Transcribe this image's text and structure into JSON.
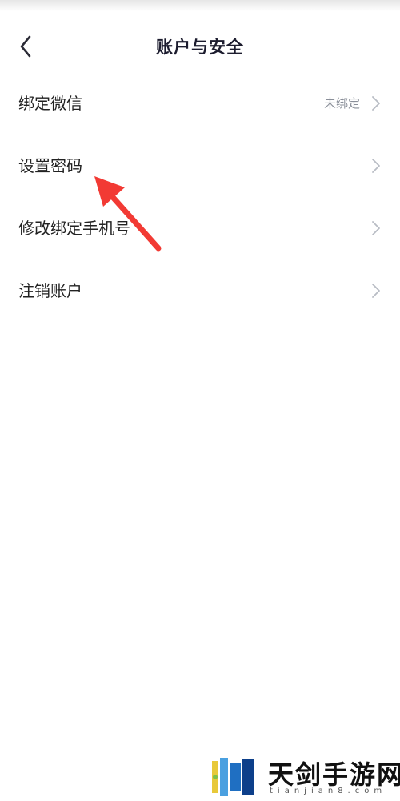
{
  "header": {
    "title": "账户与安全",
    "back_icon": "chevron-left-icon"
  },
  "menu": {
    "items": [
      {
        "label": "绑定微信",
        "value": "未绑定",
        "icon": "chevron-right-icon"
      },
      {
        "label": "设置密码",
        "value": "",
        "icon": "chevron-right-icon"
      },
      {
        "label": "修改绑定手机号",
        "value": "",
        "icon": "chevron-right-icon"
      },
      {
        "label": "注销账户",
        "value": "",
        "icon": "chevron-right-icon"
      }
    ]
  },
  "annotation": {
    "icon": "red-pointer-arrow-icon",
    "color": "#f23a34"
  },
  "watermark": {
    "name": "天剑手游网",
    "domain": "tianjian8.com",
    "icon": "tianjian-logo-icon"
  },
  "colors": {
    "title": "#1c1c2e",
    "label": "#222222",
    "secondary": "#8a8f99",
    "chevron": "#b8bcc4",
    "accent_red": "#f23a34"
  }
}
